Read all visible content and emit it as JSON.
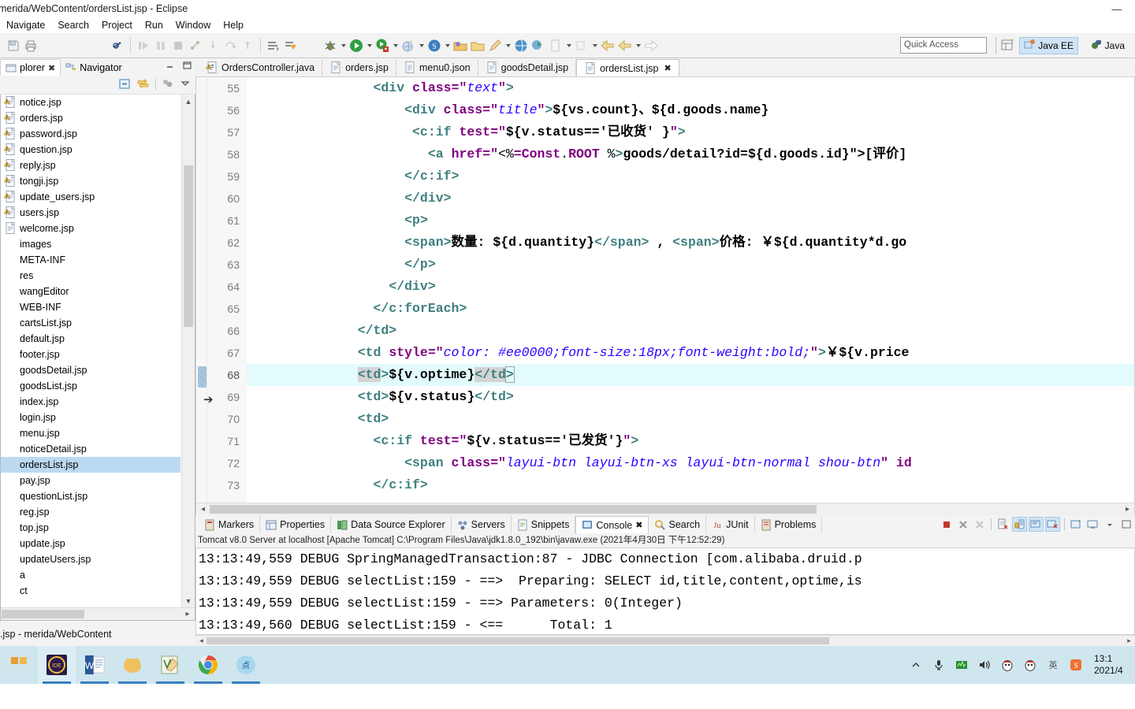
{
  "window": {
    "title": "merida/WebContent/ordersList.jsp - Eclipse",
    "minimize": "—",
    "maximize": "□",
    "close": "✕"
  },
  "menubar": {
    "items": [
      "Navigate",
      "Search",
      "Project",
      "Run",
      "Window",
      "Help"
    ]
  },
  "toolbar": {
    "quick_access_placeholder": "Quick Access",
    "perspectives": [
      {
        "label": "Java EE",
        "icon": "javaee-perspective-icon",
        "active": true
      },
      {
        "label": "Java",
        "icon": "java-perspective-icon",
        "active": false
      }
    ]
  },
  "explorer": {
    "tabs": [
      {
        "label": "plorer",
        "icon": "project-explorer-icon",
        "active": true,
        "close": "✖"
      },
      {
        "label": "Navigator",
        "icon": "navigator-icon",
        "active": false
      }
    ],
    "tree": [
      {
        "label": "notice.jsp",
        "icon": "jsp-warn-file-icon",
        "selected": false
      },
      {
        "label": "orders.jsp",
        "icon": "jsp-warn-file-icon",
        "selected": false
      },
      {
        "label": "password.jsp",
        "icon": "jsp-warn-file-icon",
        "selected": false
      },
      {
        "label": "question.jsp",
        "icon": "jsp-warn-file-icon",
        "selected": false
      },
      {
        "label": "reply.jsp",
        "icon": "jsp-warn-file-icon",
        "selected": false
      },
      {
        "label": "tongji.jsp",
        "icon": "jsp-warn-file-icon",
        "selected": false
      },
      {
        "label": "update_users.jsp",
        "icon": "jsp-warn-file-icon",
        "selected": false
      },
      {
        "label": "users.jsp",
        "icon": "jsp-warn-file-icon",
        "selected": false
      },
      {
        "label": "welcome.jsp",
        "icon": "jsp-file-icon",
        "selected": false
      },
      {
        "label": "images",
        "icon": "none",
        "selected": false
      },
      {
        "label": "META-INF",
        "icon": "none",
        "selected": false
      },
      {
        "label": "res",
        "icon": "none",
        "selected": false
      },
      {
        "label": "wangEditor",
        "icon": "none",
        "selected": false
      },
      {
        "label": "WEB-INF",
        "icon": "none",
        "selected": false
      },
      {
        "label": "cartsList.jsp",
        "icon": "none",
        "selected": false
      },
      {
        "label": "default.jsp",
        "icon": "none",
        "selected": false
      },
      {
        "label": "footer.jsp",
        "icon": "none",
        "selected": false
      },
      {
        "label": "goodsDetail.jsp",
        "icon": "none",
        "selected": false
      },
      {
        "label": "goodsList.jsp",
        "icon": "none",
        "selected": false
      },
      {
        "label": "index.jsp",
        "icon": "none",
        "selected": false
      },
      {
        "label": "login.jsp",
        "icon": "none",
        "selected": false
      },
      {
        "label": "menu.jsp",
        "icon": "none",
        "selected": false
      },
      {
        "label": "noticeDetail.jsp",
        "icon": "none",
        "selected": false
      },
      {
        "label": "ordersList.jsp",
        "icon": "none",
        "selected": true
      },
      {
        "label": "pay.jsp",
        "icon": "none",
        "selected": false
      },
      {
        "label": "questionList.jsp",
        "icon": "none",
        "selected": false
      },
      {
        "label": "reg.jsp",
        "icon": "none",
        "selected": false
      },
      {
        "label": "top.jsp",
        "icon": "none",
        "selected": false
      },
      {
        "label": "update.jsp",
        "icon": "none",
        "selected": false
      },
      {
        "label": "updateUsers.jsp",
        "icon": "none",
        "selected": false
      },
      {
        "label": "a",
        "icon": "none",
        "selected": false
      },
      {
        "label": "ct",
        "icon": "none",
        "selected": false
      }
    ],
    "status": ".jsp - merida/WebContent"
  },
  "editor": {
    "tabs": [
      {
        "label": "OrdersController.java",
        "icon": "java-warn-file-icon",
        "active": false
      },
      {
        "label": "orders.jsp",
        "icon": "jsp-file-icon",
        "active": false
      },
      {
        "label": "menu0.json",
        "icon": "json-file-icon",
        "active": false
      },
      {
        "label": "goodsDetail.jsp",
        "icon": "jsp-file-icon",
        "active": false
      },
      {
        "label": "ordersList.jsp",
        "icon": "jsp-file-icon",
        "active": true,
        "close": "✖"
      }
    ],
    "first_line": 55,
    "current_line": 68,
    "lines": [
      {
        "n": 55,
        "text": "                <div class=\"text\">"
      },
      {
        "n": 56,
        "text": "                    <div class=\"title\">${vs.count}、${d.goods.name}"
      },
      {
        "n": 57,
        "text": "                     <c:if test=\"${v.status=='已收货' }\">"
      },
      {
        "n": 58,
        "text": "                       <a href=\"<%=Const.ROOT %>goods/detail?id=${d.goods.id}\">[评价]"
      },
      {
        "n": 59,
        "text": "                    </c:if>"
      },
      {
        "n": 60,
        "text": "                    </div>"
      },
      {
        "n": 61,
        "text": "                    <p>"
      },
      {
        "n": 62,
        "text": "                    <span>数量: ${d.quantity}</span> , <span>价格: ￥${d.quantity*d.go"
      },
      {
        "n": 63,
        "text": "                    </p>"
      },
      {
        "n": 64,
        "text": "                  </div>"
      },
      {
        "n": 65,
        "text": "                </c:forEach>"
      },
      {
        "n": 66,
        "text": "              </td>"
      },
      {
        "n": 67,
        "text": "              <td style=\"color: #ee0000;font-size:18px;font-weight:bold;\">￥${v.price"
      },
      {
        "n": 68,
        "text": "              <td>${v.optime}</td>"
      },
      {
        "n": 69,
        "text": "              <td>${v.status}</td>"
      },
      {
        "n": 70,
        "text": "              <td>"
      },
      {
        "n": 71,
        "text": "                <c:if test=\"${v.status=='已发货'}\">"
      },
      {
        "n": 72,
        "text": "                    <span class=\"layui-btn layui-btn-xs layui-btn-normal shou-btn\" id"
      },
      {
        "n": 73,
        "text": "                </c:if>"
      }
    ]
  },
  "console": {
    "tabs": [
      {
        "label": "Markers",
        "icon": "markers-icon",
        "active": false
      },
      {
        "label": "Properties",
        "icon": "properties-icon",
        "active": false
      },
      {
        "label": "Data Source Explorer",
        "icon": "datasource-icon",
        "active": false
      },
      {
        "label": "Servers",
        "icon": "servers-icon",
        "active": false
      },
      {
        "label": "Snippets",
        "icon": "snippets-icon",
        "active": false
      },
      {
        "label": "Console",
        "icon": "console-icon",
        "active": true,
        "close": "✖"
      },
      {
        "label": "Search",
        "icon": "search-icon",
        "active": false
      },
      {
        "label": "JUnit",
        "icon": "junit-icon",
        "active": false
      },
      {
        "label": "Problems",
        "icon": "problems-icon",
        "active": false
      }
    ],
    "header": "Tomcat v8.0 Server at localhost [Apache Tomcat] C:\\Program Files\\Java\\jdk1.8.0_192\\bin\\javaw.exe (2021年4月30日 下午12:52:29)",
    "lines": [
      "13:13:49,559 DEBUG SpringManagedTransaction:87 - JDBC Connection [com.alibaba.druid.p",
      "13:13:49,559 DEBUG selectList:159 - ==>  Preparing: SELECT id,title,content,optime,is",
      "13:13:49,559 DEBUG selectList:159 - ==> Parameters: 0(Integer)",
      "13:13:49,560 DEBUG selectList:159 - <==      Total: 1"
    ]
  },
  "taskbar": {
    "items": [
      {
        "icon": "eclipse-ide-icon",
        "running": true,
        "active": true
      },
      {
        "icon": "word-icon",
        "running": true,
        "active": false
      },
      {
        "icon": "folder-app-icon",
        "running": true,
        "active": false
      },
      {
        "icon": "editor-app-icon",
        "running": true,
        "active": false
      },
      {
        "icon": "chrome-icon",
        "running": true,
        "active": false
      },
      {
        "icon": "browser-cn-icon",
        "running": true,
        "active": false
      }
    ],
    "tray": [
      {
        "icon": "chevron-up-icon"
      },
      {
        "icon": "microphone-icon"
      },
      {
        "icon": "network-activity-icon"
      },
      {
        "icon": "volume-icon"
      },
      {
        "icon": "qq-icon"
      },
      {
        "icon": "qq-icon-2"
      },
      {
        "icon": "ime-icon"
      },
      {
        "icon": "sogou-icon"
      }
    ],
    "clock_time": "13:1",
    "clock_date": "2021/4"
  }
}
